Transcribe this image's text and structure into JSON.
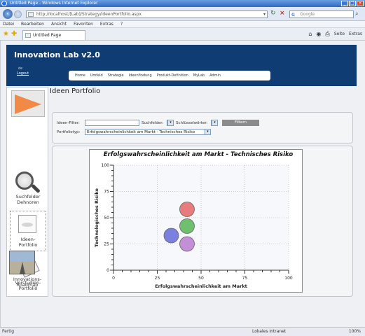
{
  "browser": {
    "title": "Untitled Page - Windows Internet Explorer",
    "url": "http://localhost/[Lab]/Strategy/IdeenPortfolio.aspx",
    "search_placeholder": "Google",
    "menu": [
      "Datei",
      "Bearbeiten",
      "Ansicht",
      "Favoriten",
      "Extras",
      "?"
    ],
    "tab_title": "Untitled Page",
    "commands": [
      "Seite",
      "Extras"
    ],
    "status_left": "Fertig",
    "status_zone": "Lokales Intranet",
    "zoom": "100%"
  },
  "app": {
    "title": "Innovation Lab v2.0",
    "user": "de",
    "logout": "Logout",
    "nav": [
      "Home",
      "Umfeld",
      "Strategie",
      "Ideenfindung",
      "Produkt-Definition",
      "MyLab",
      "Admin"
    ]
  },
  "sidebar": {
    "items": [
      {
        "label1": "Suchfelder",
        "label2": "Dehnoren"
      },
      {
        "label1": "Ideen-",
        "label2": "Portfolio"
      },
      {
        "label1": "Vorstudien-",
        "label2": "Portfolio"
      },
      {
        "label1": "Innovations-",
        "label2": "Roadmap"
      }
    ]
  },
  "page": {
    "title": "Ideen Portfolio"
  },
  "filters": {
    "ideen_filter_label": "Ideen-Filter:",
    "suchfelder_label": "Suchfelder:",
    "schlusselworter_label": "Schlüsselwörter:",
    "filter_button": "Filtern",
    "portfoliotyp_label": "Portfoliotyp:",
    "portfoliotyp_value": "Erfolgswahrscheinlichkeit am Markt - Technisches Risiko"
  },
  "chart_data": {
    "type": "scatter",
    "title": "Erfolgswahrscheinlichkeit am Markt - Technisches Risiko",
    "xlabel": "Erfolgswahrscheinlichkeit am Markt",
    "ylabel": "Technologisches Risiko",
    "xlim": [
      0,
      100
    ],
    "ylim": [
      0,
      100
    ],
    "xticks": [
      0,
      25,
      50,
      75,
      100
    ],
    "yticks": [
      0,
      25,
      50,
      75,
      100
    ],
    "grid": true,
    "points": [
      {
        "x": 42,
        "y": 58,
        "color": "#e87c7c"
      },
      {
        "x": 42,
        "y": 42,
        "color": "#6fbf6f"
      },
      {
        "x": 33,
        "y": 33,
        "color": "#7b7fe0"
      },
      {
        "x": 42,
        "y": 25,
        "color": "#c38fd6"
      }
    ]
  },
  "colors": {
    "header_bg": "#0e3c73",
    "accent_orange": "#f28a47"
  }
}
